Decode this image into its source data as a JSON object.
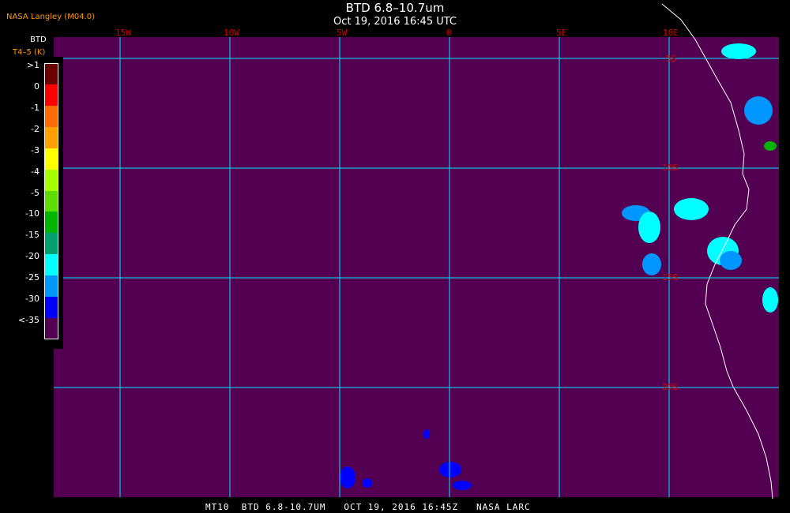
{
  "header": {
    "title": "BTD 6.8–10.7um",
    "date": "Oct 19, 2016 16:45 UTC"
  },
  "source": "NASA Langley (M04.0)",
  "legend": {
    "title": "BTD",
    "units": "T4–5 (K)",
    "entries": [
      {
        "label": ">1",
        "color": "#6a0000"
      },
      {
        "label": "0",
        "color": "#ff0000"
      },
      {
        "label": "-1",
        "color": "#ff6a00"
      },
      {
        "label": "-2",
        "color": "#ffa000"
      },
      {
        "label": "-3",
        "color": "#ffff00"
      },
      {
        "label": "-4",
        "color": "#a6ff00"
      },
      {
        "label": "-5",
        "color": "#5cdc00"
      },
      {
        "label": "-10",
        "color": "#00b400"
      },
      {
        "label": "-15",
        "color": "#00a070"
      },
      {
        "label": "-20",
        "color": "#00ffff"
      },
      {
        "label": "-25",
        "color": "#0096ff"
      },
      {
        "label": "-30",
        "color": "#0000ff"
      },
      {
        "label": "<-35",
        "color": "#540052"
      }
    ]
  },
  "map": {
    "background": "#540052",
    "grid_color": "#00e5ff",
    "label_color": "#d00000",
    "longitude_labels": [
      "15W",
      "10W",
      "5W",
      "0",
      "5E",
      "10E"
    ],
    "latitude_labels": [
      "5S",
      "10S",
      "15S",
      "20S"
    ]
  },
  "footer": "MT10  BTD 6.8-10.7UM   OCT 19, 2016 16:45Z   NASA LARC"
}
